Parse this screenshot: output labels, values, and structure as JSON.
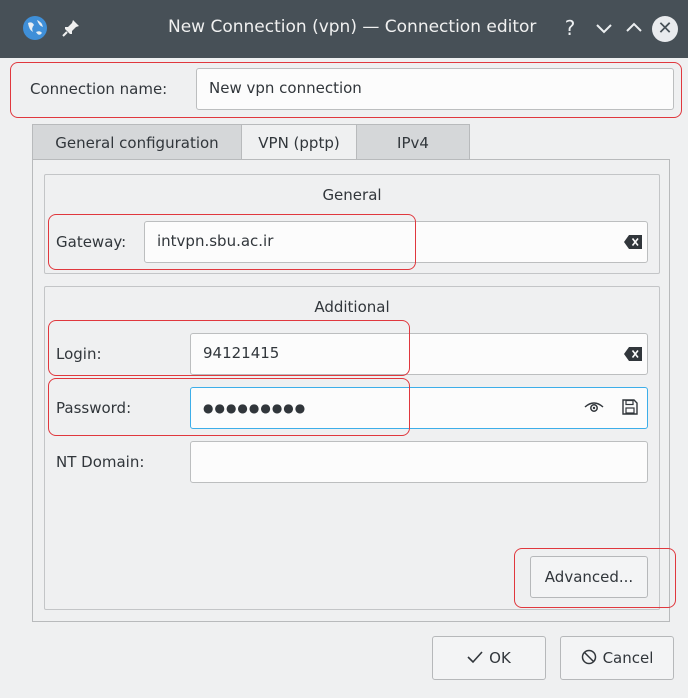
{
  "window": {
    "title": "New Connection (vpn) — Connection editor",
    "help_glyph": "?",
    "minimize_glyph": "⌄",
    "maximize_glyph": "⌃",
    "close_glyph": "✕"
  },
  "connection_name": {
    "label": "Connection name:",
    "value": "New vpn connection"
  },
  "tabs": [
    {
      "label": "General configuration",
      "active": false
    },
    {
      "label": "VPN (pptp)",
      "active": true
    },
    {
      "label": "IPv4",
      "active": false
    }
  ],
  "general_group": {
    "title": "General",
    "gateway_label": "Gateway:",
    "gateway_value": "intvpn.sbu.ac.ir"
  },
  "additional_group": {
    "title": "Additional",
    "login_label": "Login:",
    "login_value": "94121415",
    "password_label": "Password:",
    "password_value": "●●●●●●●●●",
    "nt_domain_label": "NT Domain:",
    "nt_domain_value": "",
    "advanced_button": "Advanced..."
  },
  "footer": {
    "ok_label": "OK",
    "cancel_label": "Cancel",
    "ok_icon": "checkmark-icon",
    "cancel_icon": "cancel-icon"
  },
  "colors": {
    "titlebar": "#475057",
    "highlight": "#e0383e",
    "focus": "#3daee9"
  }
}
